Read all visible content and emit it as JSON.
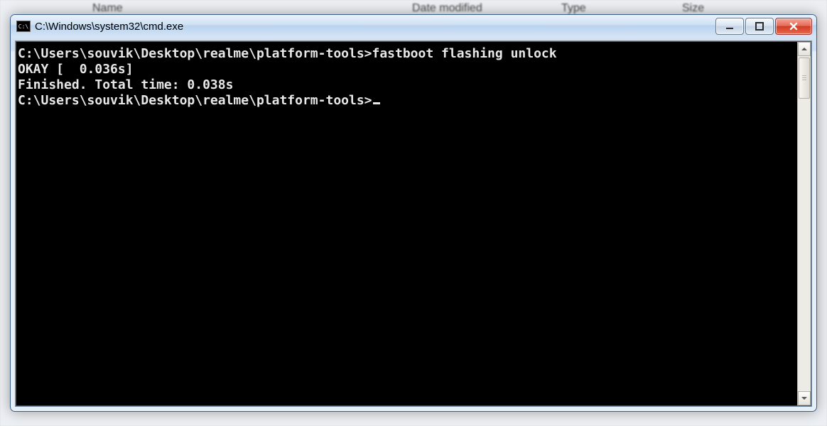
{
  "background": {
    "col_name": "Name",
    "col_date": "Date modified",
    "col_type": "Type",
    "col_size": "Size"
  },
  "window": {
    "title": "C:\\Windows\\system32\\cmd.exe"
  },
  "terminal": {
    "prompt": "C:\\Users\\souvik\\Desktop\\realme\\platform-tools>",
    "command": "fastboot flashing unlock",
    "out1": "OKAY [  0.036s]",
    "out2": "Finished. Total time: 0.038s",
    "currentPrompt": "C:\\Users\\souvik\\Desktop\\realme\\platform-tools>"
  }
}
